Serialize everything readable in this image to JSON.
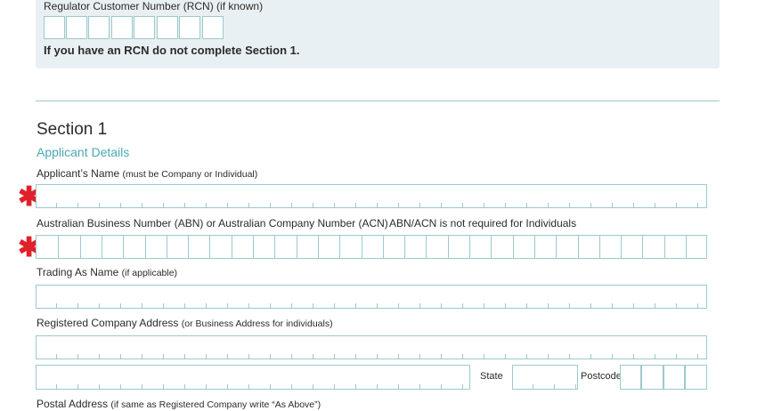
{
  "rcn": {
    "label": "Regulator Customer Number (RCN) (if known)",
    "notice": "If you have an RCN do not complete Section 1."
  },
  "section": {
    "title": "Section 1",
    "subtitle": "Applicant Details"
  },
  "fields": {
    "applicant_name_label": "Applicant’s Name",
    "applicant_name_hint": "(must be Company or Individual)",
    "abn_label": "Australian Business Number (ABN) or Australian Company Number (ACN)",
    "abn_note": "ABN/ACN is not required for Individuals",
    "trading_label": "Trading As Name",
    "trading_hint": "(if applicable)",
    "registered_label": "Registered Company Address",
    "registered_hint": "(or Business Address for individuals)",
    "state_label": "State",
    "postcode_label": "Postcode",
    "postal_label": "Postal Address",
    "postal_hint": "(if same as Registered Company write “As Above”)"
  },
  "colors": {
    "border": "#9cc9cc",
    "accent": "#4aa8b4",
    "required": "#e0202a",
    "panel": "#e9f0f3"
  }
}
